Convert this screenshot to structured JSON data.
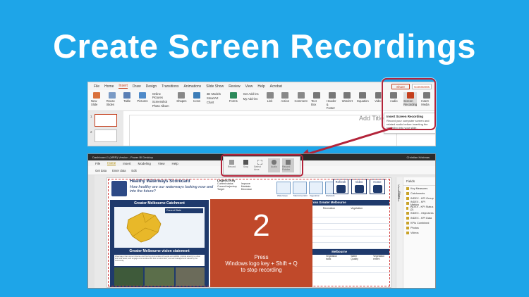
{
  "hero": {
    "title": "Create Screen Recordings"
  },
  "powerpoint": {
    "tabs": [
      "File",
      "Home",
      "Insert",
      "Draw",
      "Design",
      "Transitions",
      "Animations",
      "Slide Show",
      "Review",
      "View",
      "Help",
      "Acrobat"
    ],
    "active_tab": "Insert",
    "share_label": "Share",
    "comments_label": "Comments",
    "ribbon": [
      {
        "label": "New Slide",
        "color": "#d9703b"
      },
      {
        "label": "Reuse Slides",
        "color": "#7a9ac5"
      },
      {
        "label": "Table",
        "color": "#5a7fb5"
      },
      {
        "label": "Pictures",
        "color": "#4f8ac9"
      },
      {
        "label": "Shapes",
        "color": "#888"
      },
      {
        "label": "Icons",
        "color": "#3c7db8"
      },
      {
        "label": "Chart",
        "color": "#3aa04b"
      },
      {
        "label": "Forms",
        "color": "#2c8a5a"
      },
      {
        "label": "Link",
        "color": "#888"
      },
      {
        "label": "Action",
        "color": "#888"
      },
      {
        "label": "Comment",
        "color": "#888"
      },
      {
        "label": "Text Box",
        "color": "#777"
      },
      {
        "label": "Header & Footer",
        "color": "#777"
      },
      {
        "label": "WordArt",
        "color": "#777"
      },
      {
        "label": "Equation",
        "color": "#777"
      },
      {
        "label": "Video",
        "color": "#777"
      },
      {
        "label": "Audio",
        "color": "#777"
      },
      {
        "label": "Screen Recording",
        "color": "#c43e1c"
      },
      {
        "label": "Insert Media",
        "color": "#777"
      }
    ],
    "group_labels": [
      "Slides",
      "Tables",
      "Images",
      "Illustrations",
      "Forms",
      "Add-ins",
      "Links",
      "Comments",
      "Text",
      "Symbols",
      "Media"
    ],
    "pictures_menu": [
      "Online Pictures",
      "Screenshot",
      "Photo Album"
    ],
    "illus_menu": [
      "3D Models",
      "SmartArt",
      "Chart"
    ],
    "addins": [
      "Get Add-ins",
      "My Add-ins"
    ],
    "slide_numbers": [
      "1",
      "2"
    ],
    "add_title_hint": "Add Title",
    "tooltip": {
      "title": "Insert Screen Recording",
      "body": "Record your computer screen and related audio before inserting the recording into your slide."
    }
  },
  "powerbi": {
    "title": "Dashboard-1 (MRR) Version - Power BI Desktop",
    "user": "Christian Kristmas",
    "menu": [
      "File",
      "Home",
      "Insert",
      "Modeling",
      "View",
      "Help"
    ],
    "toolbar": [
      "Get data",
      "Enter data",
      "Edit",
      "Refresh",
      "New visual",
      "New measure",
      "Publish"
    ],
    "report": {
      "title": "Healthy Waterways Scorecard",
      "subtitle": "How healthy are our waterways looking now and into the future?",
      "legend_title": "Legend Key",
      "legend_items": [
        "Current status",
        "Current trajectory",
        "Target",
        "Improve",
        "Maintain",
        "Decrease"
      ],
      "categories": [
        "Waterways",
        "Macroinvertebrates",
        "Vegetation",
        "Wetlands"
      ],
      "nav_buttons": [
        "Refresh",
        "Video",
        "Home"
      ],
      "catchment_header": "Greater Melbourne Catchment",
      "current_state": "Current State",
      "vision_header": "Greater Melbourne vision statement",
      "vision_text": "Waterways that connect diverse and thriving communities of people and wildlife, provide amenity to urban and rural areas, and engage communities with their environment, are well managed and valued by the community.",
      "table_header": "Environmental scorecard for Rivers across Greater Melbourne",
      "table_cols": [
        "Platypus",
        "Recreation",
        "Vegetation"
      ],
      "table_header2": "Melbourne",
      "table_cols2": [
        "Vegetation bank",
        "Water Quality",
        "Vegetation extent"
      ]
    },
    "filters_label": "Filters",
    "viz_label": "Visualizations",
    "fields_title": "Fields",
    "fields": [
      "Key Measures",
      "Catchments",
      "INDEX - KPI Group",
      "INDEX - KPI Metrics",
      "INDEX - KPI Status (2)",
      "INDEX - Objectives",
      "INDEX - KPI Data",
      "KPIs Combined",
      "Photos",
      "Videos"
    ]
  },
  "recorder": {
    "buttons": [
      "Record",
      "Stop",
      "Select Area",
      "Audio",
      "Record Pointer"
    ]
  },
  "countdown": {
    "number": "2",
    "line1": "Press",
    "line2": "Windows logo key + Shift + Q",
    "line3": "to stop recording",
    "bg": "#c0492a"
  },
  "colors": {
    "background": "#1ea5e8",
    "highlight": "#b3243a",
    "report_navy": "#1f3a6c"
  }
}
